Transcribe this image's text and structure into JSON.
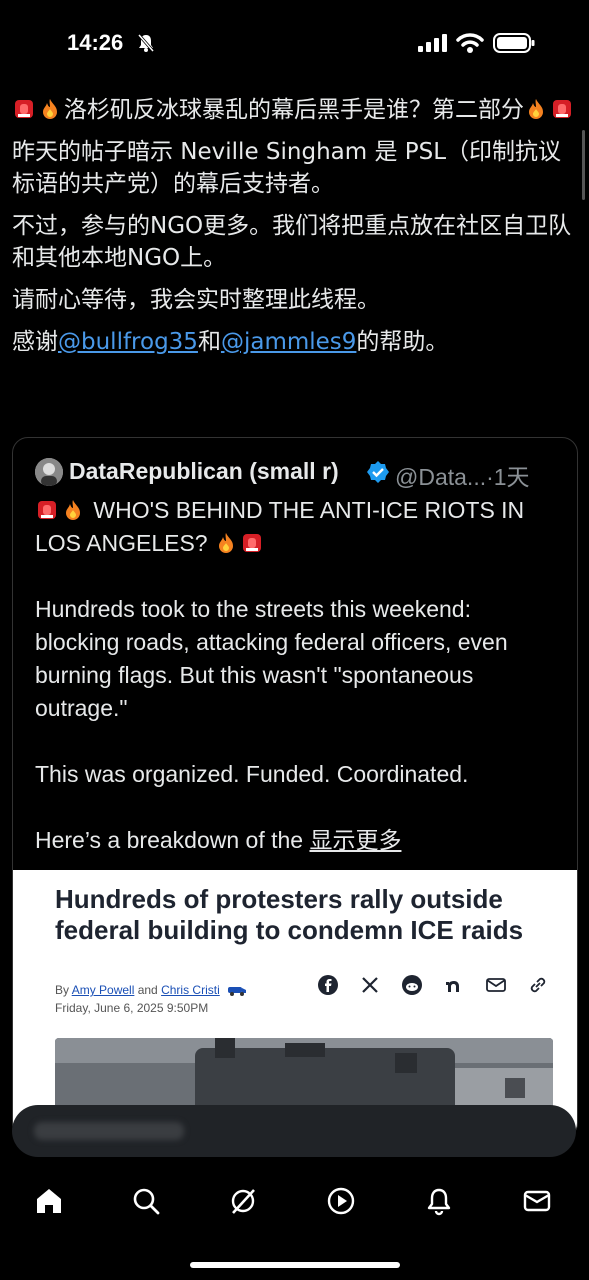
{
  "status_bar": {
    "time": "14:26"
  },
  "post": {
    "line1": "洛杉矶反冰球暴乱的幕后黑手是谁？第二部分",
    "line2": "昨天的帖子暗示 Neville Singham 是 PSL（印制抗议标语的共产党）的幕后支持者。",
    "line3": "不过，参与的NGO更多。我们将把重点放在社区自卫队和其他本地NGO上。",
    "line4": "请耐心等待，我会实时整理此线程。",
    "thanks_prefix": "感谢",
    "mention1": "@bullfrog35",
    "thanks_and": "和",
    "mention2": "@jammles9",
    "thanks_suffix": "的帮助。"
  },
  "quote": {
    "name": "DataRepublican (small r)",
    "handle_time": "@Data...·1天",
    "headline": "WHO'S BEHIND THE ANTI-ICE RIOTS IN LOS ANGELES?",
    "para1": "Hundreds took to the streets this weekend: blocking roads, attacking federal officers, even burning flags. But this wasn't \"spontaneous outrage.\"",
    "para2": "This was organized. Funded. Coordinated.",
    "para3": "Here’s a breakdown of the ",
    "show_more": "显示更多"
  },
  "article": {
    "title": "Hundreds of protesters rally outside federal building to condemn ICE raids",
    "by": "By ",
    "author1": "Amy Powell",
    "and": " and ",
    "author2": "Chris Cristi",
    "date": "Friday, June 6, 2025 9:50PM"
  },
  "icons": [
    "facebook-icon",
    "x-icon",
    "reddit-icon",
    "nextdoor-icon",
    "email-icon",
    "link-icon",
    "home-icon",
    "search-icon",
    "grok-icon",
    "video-icon",
    "notifications-icon",
    "messages-icon"
  ]
}
